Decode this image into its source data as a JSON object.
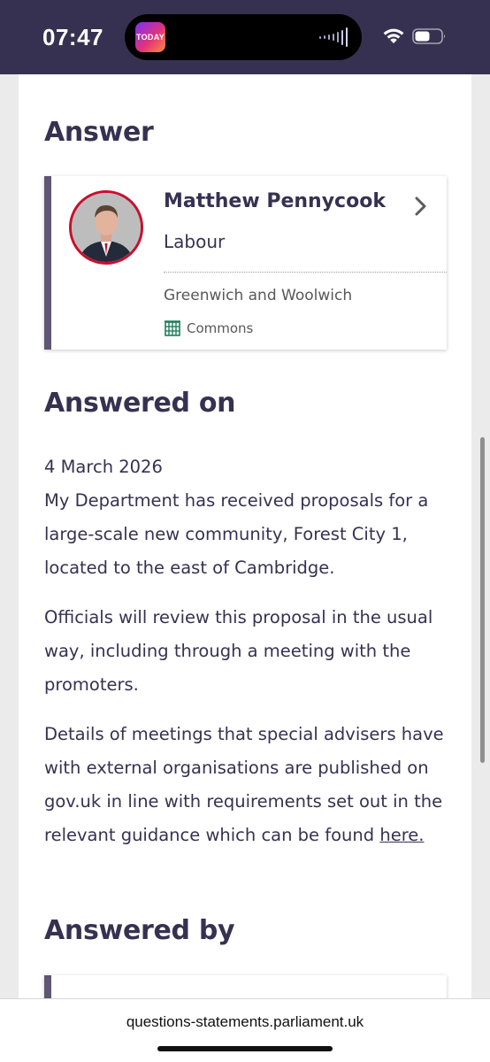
{
  "status_bar": {
    "time": "07:47",
    "app_badge": "TODAY",
    "icons": [
      "audio-bars-icon",
      "wifi-icon",
      "battery-icon"
    ]
  },
  "answer_section": {
    "heading": "Answer",
    "member": {
      "name": "Matthew Pennycook",
      "party": "Labour",
      "constituency": "Greenwich and Woolwich",
      "house": "Commons"
    }
  },
  "answered_on_section": {
    "heading": "Answered on",
    "date": "4 March 2026",
    "paragraph_1": "My Department has received proposals for a large-scale new community, Forest City 1, located to the east of Cambridge.",
    "paragraph_2": "Officials will review this proposal in the usual way, including through a meeting with the promoters.",
    "paragraph_3": "Details of meetings that special advisers have with external organisations are published on gov.uk in line with requirements set out in the relevant guidance which can be found",
    "link_text": "here."
  },
  "answered_by_section": {
    "heading": "Answered by"
  },
  "browser": {
    "url": "questions-statements.parliament.uk"
  },
  "colors": {
    "primary": "#373151",
    "card_accent": "#5e5673",
    "avatar_ring": "#c8102e",
    "commons_green": "#1d7f5f"
  }
}
